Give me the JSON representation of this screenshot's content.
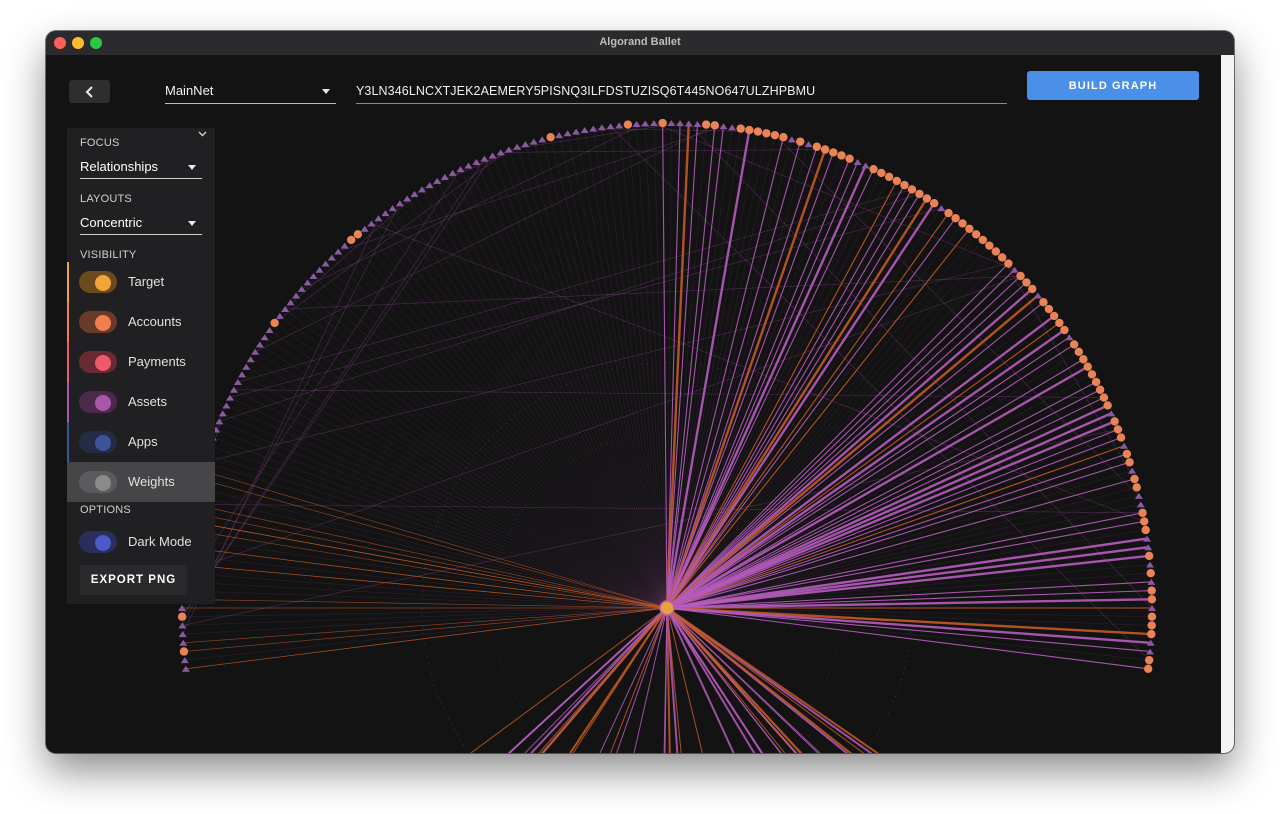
{
  "window": {
    "title": "Algorand Ballet"
  },
  "toolbar": {
    "back_icon": "chevron-left-icon",
    "network": "MainNet",
    "address": "Y3LN346LNCXTJEK2AEMERY5PISNQ3ILFDSTUZISQ6T445NO647ULZHPBMU",
    "build_label": "BUILD GRAPH"
  },
  "panel": {
    "focus_label": "FOCUS",
    "focus_value": "Relationships",
    "layouts_label": "LAYOUTS",
    "layouts_value": "Concentric",
    "visibility_label": "VISIBILITY",
    "visibility": [
      {
        "label": "Target",
        "color": "#f2a33a",
        "on": true
      },
      {
        "label": "Accounts",
        "color": "#ef7f4f",
        "on": true
      },
      {
        "label": "Payments",
        "color": "#ec5a6b",
        "on": true
      },
      {
        "label": "Assets",
        "color": "#a958a5",
        "on": true
      },
      {
        "label": "Apps",
        "color": "#3c5598",
        "on": true
      },
      {
        "label": "Weights",
        "color": "#8a8a8a",
        "on": true
      }
    ],
    "options_label": "OPTIONS",
    "dark_mode_label": "Dark Mode",
    "dark_mode_color": "#4a5ac8",
    "export_label": "EXPORT PNG"
  },
  "colors": {
    "accent": "#4a8fe8",
    "account_node": "#ea8457",
    "asset_edge": "#b65cbc",
    "payment_edge": "#c45a22"
  }
}
